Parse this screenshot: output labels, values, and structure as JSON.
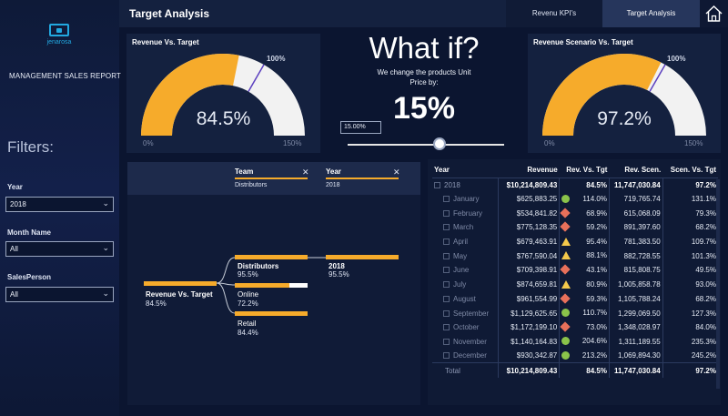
{
  "sidebar": {
    "logo_text": "jenarosa",
    "report_title": "MANAGEMENT SALES REPORT",
    "filters_title": "Filters:",
    "filters": [
      {
        "label": "Year",
        "value": "2018"
      },
      {
        "label": "Month Name",
        "value": "All"
      },
      {
        "label": "SalesPerson",
        "value": "All"
      }
    ]
  },
  "header": {
    "title": "Target Analysis",
    "tabs": [
      {
        "label": "Revenu KPI's"
      },
      {
        "label": "Target Analysis"
      }
    ],
    "active_tab": "Target Analysis"
  },
  "gauge_left": {
    "title": "Revenue Vs. Target",
    "value": "84.5%",
    "min": "0%",
    "max": "150%",
    "target": "100%",
    "fill_fraction": 0.563
  },
  "gauge_right": {
    "title": "Revenue Scenario Vs. Target",
    "value": "97.2%",
    "min": "0%",
    "max": "150%",
    "target": "100%",
    "fill_fraction": 0.648
  },
  "whatif": {
    "title": "What if?",
    "subtitle": "We change the products Unit Price by:",
    "value": "15%",
    "input_value": "15.00%",
    "slider_fraction": 0.6
  },
  "decomposition": {
    "levels": [
      {
        "name": "Team",
        "value": "Distributors"
      },
      {
        "name": "Year",
        "value": "2018"
      }
    ],
    "root": {
      "label": "Revenue Vs. Target",
      "value": "84.5%"
    },
    "children": [
      {
        "label": "Distributors",
        "value": "95.5%",
        "fraction": 1.0
      },
      {
        "label": "Online",
        "value": "72.2%",
        "fraction": 0.75
      },
      {
        "label": "Retail",
        "value": "84.4%",
        "fraction": 1.0
      }
    ],
    "leaf": {
      "label": "2018",
      "value": "95.5%"
    }
  },
  "table": {
    "headers": [
      "Year",
      "Revenue",
      "Rev. Vs. Tgt",
      "Rev. Scen.",
      "Scen. Vs. Tgt"
    ],
    "year_row": {
      "label": "2018",
      "revenue": "$10,214,809.43",
      "rev_vs_tgt": "84.5%",
      "rev_scen": "11,747,030.84",
      "scen_vs_tgt": "97.2%"
    },
    "rows": [
      {
        "month": "January",
        "revenue": "$625,883.25",
        "indicator": "green",
        "rev_vs_tgt": "114.0%",
        "rev_scen": "719,765.74",
        "scen_vs_tgt": "131.1%"
      },
      {
        "month": "February",
        "revenue": "$534,841.82",
        "indicator": "red",
        "rev_vs_tgt": "68.9%",
        "rev_scen": "615,068.09",
        "scen_vs_tgt": "79.3%"
      },
      {
        "month": "March",
        "revenue": "$775,128.35",
        "indicator": "red",
        "rev_vs_tgt": "59.2%",
        "rev_scen": "891,397.60",
        "scen_vs_tgt": "68.2%"
      },
      {
        "month": "April",
        "revenue": "$679,463.91",
        "indicator": "yellow",
        "rev_vs_tgt": "95.4%",
        "rev_scen": "781,383.50",
        "scen_vs_tgt": "109.7%"
      },
      {
        "month": "May",
        "revenue": "$767,590.04",
        "indicator": "yellow",
        "rev_vs_tgt": "88.1%",
        "rev_scen": "882,728.55",
        "scen_vs_tgt": "101.3%"
      },
      {
        "month": "June",
        "revenue": "$709,398.91",
        "indicator": "red",
        "rev_vs_tgt": "43.1%",
        "rev_scen": "815,808.75",
        "scen_vs_tgt": "49.5%"
      },
      {
        "month": "July",
        "revenue": "$874,659.81",
        "indicator": "yellow",
        "rev_vs_tgt": "80.9%",
        "rev_scen": "1,005,858.78",
        "scen_vs_tgt": "93.0%"
      },
      {
        "month": "August",
        "revenue": "$961,554.99",
        "indicator": "red",
        "rev_vs_tgt": "59.3%",
        "rev_scen": "1,105,788.24",
        "scen_vs_tgt": "68.2%"
      },
      {
        "month": "September",
        "revenue": "$1,129,625.65",
        "indicator": "green",
        "rev_vs_tgt": "110.7%",
        "rev_scen": "1,299,069.50",
        "scen_vs_tgt": "127.3%"
      },
      {
        "month": "October",
        "revenue": "$1,172,199.10",
        "indicator": "red",
        "rev_vs_tgt": "73.0%",
        "rev_scen": "1,348,028.97",
        "scen_vs_tgt": "84.0%"
      },
      {
        "month": "November",
        "revenue": "$1,140,164.83",
        "indicator": "green",
        "rev_vs_tgt": "204.6%",
        "rev_scen": "1,311,189.55",
        "scen_vs_tgt": "235.3%"
      },
      {
        "month": "December",
        "revenue": "$930,342.87",
        "indicator": "green",
        "rev_vs_tgt": "213.2%",
        "rev_scen": "1,069,894.30",
        "scen_vs_tgt": "245.2%"
      }
    ],
    "total_row": {
      "label": "Total",
      "revenue": "$10,214,809.43",
      "rev_vs_tgt": "84.5%",
      "rev_scen": "11,747,030.84",
      "scen_vs_tgt": "97.2%"
    }
  },
  "colors": {
    "accent": "#f6ab2b",
    "gauge_track": "#f2f2f2",
    "target_line": "#5b3fbf",
    "green": "#8bc34a",
    "red": "#e8705a",
    "yellow": "#f3c84b",
    "background": "#0b1530",
    "panel": "#14213f"
  }
}
